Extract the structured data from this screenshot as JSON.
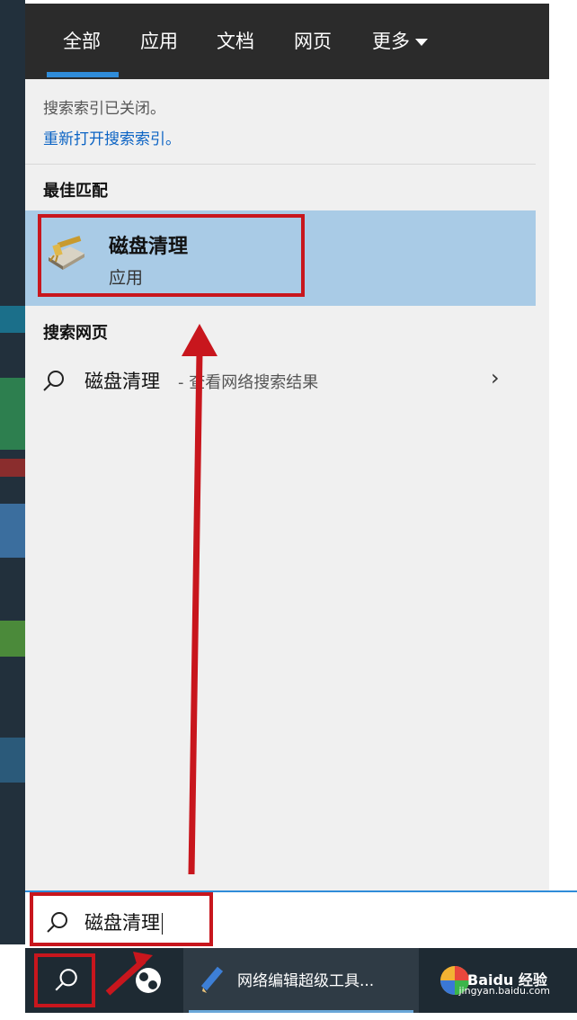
{
  "tabs": [
    {
      "label": "全部",
      "active": true
    },
    {
      "label": "应用",
      "active": false
    },
    {
      "label": "文档",
      "active": false
    },
    {
      "label": "网页",
      "active": false
    },
    {
      "label": "更多",
      "active": false,
      "dropdown": true
    }
  ],
  "notice": {
    "text": "搜索索引已关闭。",
    "link": "重新打开搜索索引。"
  },
  "best_match": {
    "heading": "最佳匹配",
    "name": "磁盘清理",
    "type": "应用",
    "icon": "disk-cleanup-icon"
  },
  "web": {
    "heading": "搜索网页",
    "query": "磁盘清理",
    "suffix": "- 查看网络搜索结果"
  },
  "search_box": {
    "value": "磁盘清理"
  },
  "taskbar": {
    "task_label": "网络编辑超级工具...",
    "watermark": "jingyan.baidu.com",
    "watermark_brand": "Baidu 经验"
  },
  "colors": {
    "accent": "#2f8cd9",
    "annotation": "#c8161d",
    "selected": "#a9cbe6"
  }
}
